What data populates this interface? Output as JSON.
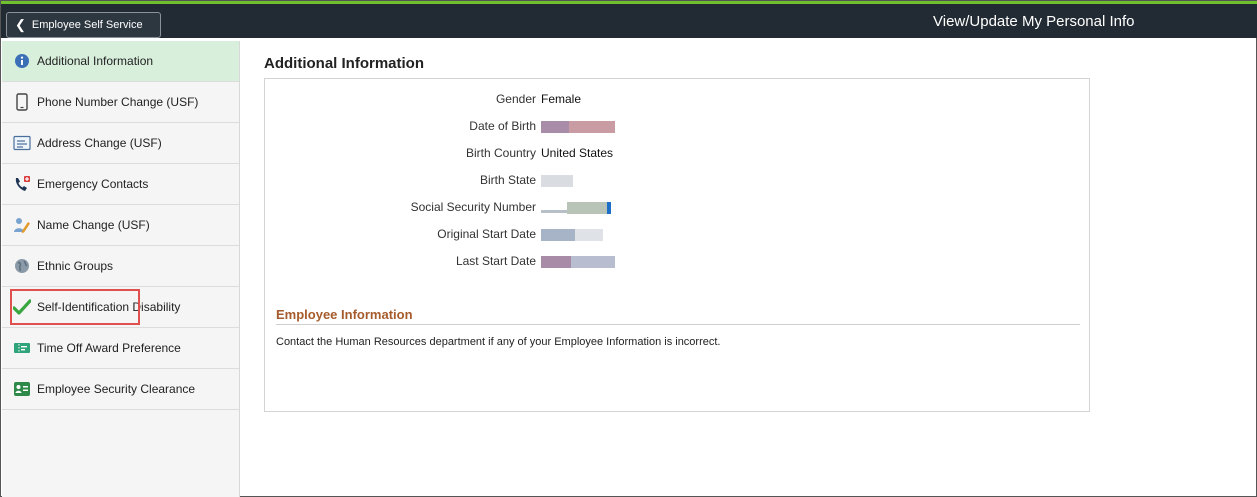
{
  "header": {
    "back_label": "Employee Self Service",
    "title": "View/Update My Personal Info"
  },
  "sidebar": {
    "items": [
      {
        "label": "Additional Information",
        "icon": "info-icon"
      },
      {
        "label": "Phone Number Change (USF)",
        "icon": "phone-icon"
      },
      {
        "label": "Address Change (USF)",
        "icon": "address-card-icon"
      },
      {
        "label": "Emergency Contacts",
        "icon": "emergency-phone-icon"
      },
      {
        "label": "Name Change (USF)",
        "icon": "person-pencil-icon"
      },
      {
        "label": "Ethnic Groups",
        "icon": "globe-icon"
      },
      {
        "label": "Self-Identification Disability",
        "icon": "checkmark-icon"
      },
      {
        "label": "Time Off Award Preference",
        "icon": "ticket-icon"
      },
      {
        "label": "Employee Security Clearance",
        "icon": "id-badge-icon"
      }
    ]
  },
  "main": {
    "title": "Additional Information",
    "fields": [
      {
        "label": "Gender",
        "value": "Female"
      },
      {
        "label": "Date of Birth",
        "value": ""
      },
      {
        "label": "Birth Country",
        "value": "United States"
      },
      {
        "label": "Birth State",
        "value": ""
      },
      {
        "label": "Social Security Number",
        "value": ""
      },
      {
        "label": "Original Start Date",
        "value": ""
      },
      {
        "label": "Last Start Date",
        "value": ""
      }
    ],
    "employee_info": {
      "title": "Employee Information",
      "text": "Contact the Human Resources department if any of your Employee Information is incorrect."
    }
  },
  "colors": {
    "topbar": "#222b33",
    "accent_green": "#6fbf2e",
    "active_item": "#d8efdc",
    "highlight": "#e0504f",
    "section_title": "#a65b2c"
  }
}
